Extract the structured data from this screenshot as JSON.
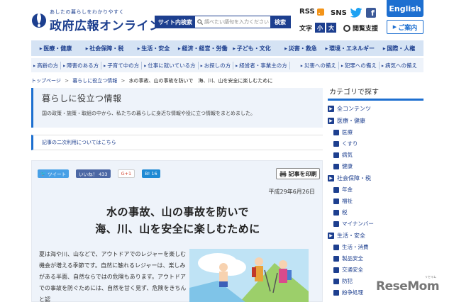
{
  "header": {
    "logo_tagline": "あしたの暮らしをわかりやすく",
    "logo_title": "政府広報オンライン",
    "search_label": "サイト内検索",
    "search_placeholder": "調べたい語句を入力ください",
    "search_button": "検索",
    "rss": "RSS",
    "sns": "SNS",
    "facebook": "f",
    "english": "English",
    "text_size_label": "文字",
    "text_size_small": "小",
    "text_size_large": "大",
    "accessibility": "閲覧支援",
    "contact": "ご案内"
  },
  "nav_primary": [
    "医療・健康",
    "社会保障・税",
    "生活・安全",
    "経済・経営・労働",
    "子ども・文化",
    "災害・救急",
    "環境・エネルギー",
    "国際・人権"
  ],
  "nav_secondary_left": [
    "高齢の方",
    "障害のある方",
    "子育て中の方",
    "仕事に就いている方",
    "お探しの方",
    "経営者・事業主の方"
  ],
  "nav_secondary_right": [
    "災害への備え",
    "犯罪への備え",
    "病気への備え"
  ],
  "breadcrumb": {
    "home": "トップページ",
    "section": "暮らしに役立つ情報",
    "current": "水の事故、山の事故を防いで　海、川、山を安全に楽しむために",
    "separator": ">"
  },
  "page": {
    "title": "暮らしに役立つ情報",
    "description": "国の政策・施策・取組の中から、私たちの暮らしに身近な情報や役に立つ情報をまとめました。",
    "notice": "記事の二次利用についてはこちら"
  },
  "share": {
    "tweet": "ツイート",
    "like": "いいね！ 433",
    "gplus": "G+1",
    "hatena": "B! 16",
    "print": "記事を印刷"
  },
  "article": {
    "date": "平成29年6月26日",
    "title_line1": "水の事故、山の事故を防いで",
    "title_line2": "海、川、山を安全に楽しむために",
    "body": "夏は海や川、山などで、アウトドアでのレジャーを楽しむ機会が増える季節です。自然に触れるレジャーは、楽しみがある半面、自然ならではの危険もあります。アウトドアでの事故を防ぐためには、自然を甘く見ず、危険をきちんと認"
  },
  "sidebar": {
    "heading": "カテゴリで探す",
    "items": [
      {
        "type": "cat",
        "label": "全コンテンツ"
      },
      {
        "type": "cat",
        "label": "医療・健康"
      },
      {
        "type": "sub",
        "label": "医療"
      },
      {
        "type": "sub",
        "label": "くすり"
      },
      {
        "type": "sub",
        "label": "病気"
      },
      {
        "type": "sub",
        "label": "健康"
      },
      {
        "type": "cat",
        "label": "社会保障・税"
      },
      {
        "type": "sub",
        "label": "年金"
      },
      {
        "type": "sub",
        "label": "福祉"
      },
      {
        "type": "sub",
        "label": "税"
      },
      {
        "type": "sub",
        "label": "マイナンバー"
      },
      {
        "type": "cat",
        "label": "生活・安全"
      },
      {
        "type": "sub",
        "label": "生活・消費"
      },
      {
        "type": "sub",
        "label": "製品安全"
      },
      {
        "type": "sub",
        "label": "交通安全"
      },
      {
        "type": "sub",
        "label": "防犯"
      },
      {
        "type": "sub",
        "label": "紛争処理"
      }
    ]
  },
  "watermark": "ReseMom",
  "watermark_small": "リセマム",
  "colors": {
    "brand": "#1d3f8f",
    "accent": "#1d6fd0",
    "nav_bg": "#d5e3f4",
    "panel_bg": "#eef3fa"
  }
}
